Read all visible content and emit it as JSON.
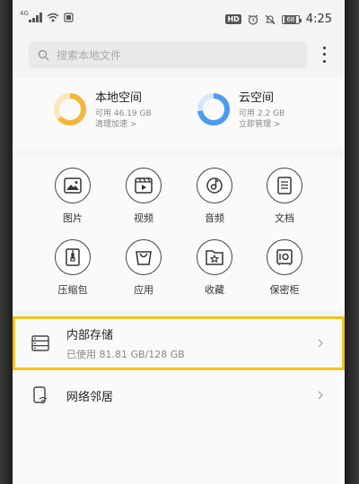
{
  "status_bar": {
    "network_label": "4G",
    "hd_badge": "HD",
    "battery_level": "68",
    "time": "4:25"
  },
  "search": {
    "placeholder": "搜索本地文件"
  },
  "storage": {
    "local": {
      "title": "本地空间",
      "available": "可用 46.19 GB",
      "action": "清理加速 >",
      "used_fraction": 0.64,
      "color": "#f5b73b"
    },
    "cloud": {
      "title": "云空间",
      "available": "可用 2.2 GB",
      "action": "立即管理 >",
      "used_fraction": 0.73,
      "color": "#4b9bf0"
    }
  },
  "categories": [
    {
      "label": "图片",
      "icon": "image-icon"
    },
    {
      "label": "视频",
      "icon": "video-icon"
    },
    {
      "label": "音频",
      "icon": "audio-icon"
    },
    {
      "label": "文档",
      "icon": "document-icon"
    },
    {
      "label": "压缩包",
      "icon": "archive-icon"
    },
    {
      "label": "应用",
      "icon": "app-package-icon"
    },
    {
      "label": "收藏",
      "icon": "favorites-icon"
    },
    {
      "label": "保密柜",
      "icon": "safe-icon"
    }
  ],
  "list": {
    "internal": {
      "title": "内部存储",
      "subtitle": "已使用 81.81 GB/128 GB",
      "icon": "storage-icon"
    },
    "network": {
      "title": "网络邻居",
      "icon": "network-neighbor-icon"
    }
  },
  "colors": {
    "highlight": "#f2c419",
    "background": "#f4f4f4"
  }
}
